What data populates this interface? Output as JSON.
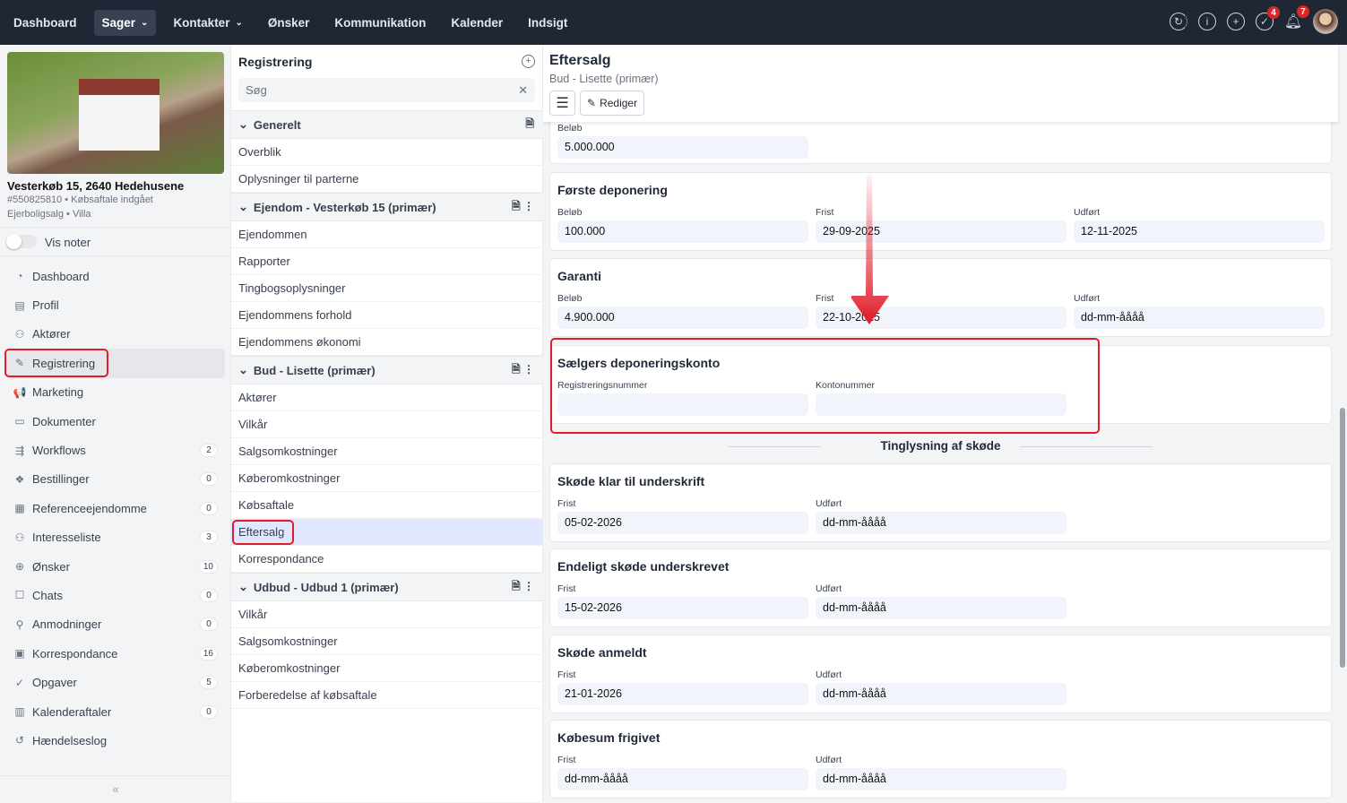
{
  "topnav": [
    {
      "label": "Dashboard"
    },
    {
      "label": "Sager",
      "active": true,
      "chevron": true
    },
    {
      "label": "Kontakter",
      "chevron": true
    },
    {
      "label": "Ønsker"
    },
    {
      "label": "Kommunikation"
    },
    {
      "label": "Kalender"
    },
    {
      "label": "Indsigt"
    }
  ],
  "top_icons": {
    "refresh": "refresh-icon",
    "info": "info-icon",
    "add": "plus-circle-icon",
    "tasks_badge": "4",
    "notifications_badge": "7"
  },
  "property": {
    "address": "Vesterkøb 15, 2640 Hedehusene",
    "case_line": "#550825810 • Købsaftale indgået",
    "type_line": "Ejerboligsalg • Villa",
    "notes_toggle": "Vis noter"
  },
  "menu": [
    {
      "label": "Dashboard",
      "icon": "◔",
      "count": null
    },
    {
      "label": "Profil",
      "icon": "▤",
      "count": null
    },
    {
      "label": "Aktører",
      "icon": "⚇",
      "count": null
    },
    {
      "label": "Registrering",
      "icon": "✎",
      "count": null,
      "active": true
    },
    {
      "label": "Marketing",
      "icon": "📢",
      "count": null
    },
    {
      "label": "Dokumenter",
      "icon": "▭",
      "count": null
    },
    {
      "label": "Workflows",
      "icon": "⇶",
      "count": "2"
    },
    {
      "label": "Bestillinger",
      "icon": "❖",
      "count": "0"
    },
    {
      "label": "Referenceejendomme",
      "icon": "▦",
      "count": "0"
    },
    {
      "label": "Interesseliste",
      "icon": "⚇",
      "count": "3"
    },
    {
      "label": "Ønsker",
      "icon": "⊕",
      "count": "10"
    },
    {
      "label": "Chats",
      "icon": "☐",
      "count": "0"
    },
    {
      "label": "Anmodninger",
      "icon": "⚲",
      "count": "0"
    },
    {
      "label": "Korrespondance",
      "icon": "▣",
      "count": "16"
    },
    {
      "label": "Opgaver",
      "icon": "✓",
      "count": "5"
    },
    {
      "label": "Kalenderaftaler",
      "icon": "▥",
      "count": "0"
    },
    {
      "label": "Hændelseslog",
      "icon": "↺",
      "count": null
    }
  ],
  "registrering": {
    "title": "Registrering",
    "search_placeholder": "Søg",
    "groups": [
      {
        "label": "Generelt",
        "items": [
          "Overblik",
          "Oplysninger til parterne"
        ],
        "more": false
      },
      {
        "label": "Ejendom - Vesterkøb 15 (primær)",
        "items": [
          "Ejendommen",
          "Rapporter",
          "Tingbogsoplysninger",
          "Ejendommens forhold",
          "Ejendommens økonomi"
        ],
        "more": true
      },
      {
        "label": "Bud - Lisette (primær)",
        "items": [
          "Aktører",
          "Vilkår",
          "Salgsomkostninger",
          "Køberomkostninger",
          "Købsaftale",
          "Eftersalg",
          "Korrespondance"
        ],
        "more": true
      },
      {
        "label": "Udbud - Udbud 1 (primær)",
        "items": [
          "Vilkår",
          "Salgsomkostninger",
          "Køberomkostninger",
          "Forberedelse af købsaftale"
        ],
        "more": true
      }
    ]
  },
  "main": {
    "title": "Eftersalg",
    "subtitle": "Bud - Lisette (primær)",
    "edit_label": "Rediger",
    "top_amount": {
      "label": "Beløb",
      "value": "5.000.000"
    },
    "cards1": [
      {
        "title": "Første deponering",
        "fields": [
          {
            "label": "Beløb",
            "value": "100.000"
          },
          {
            "label": "Frist",
            "value": "29-09-2025"
          },
          {
            "label": "Udført",
            "value": "12-11-2025"
          }
        ]
      },
      {
        "title": "Garanti",
        "fields": [
          {
            "label": "Beløb",
            "value": "4.900.000"
          },
          {
            "label": "Frist",
            "value": "22-10-2025"
          },
          {
            "label": "Udført",
            "value": "dd-mm-åååå"
          }
        ]
      },
      {
        "title": "Sælgers deponeringskonto",
        "fields": [
          {
            "label": "Registreringsnummer",
            "value": ""
          },
          {
            "label": "Kontonummer",
            "value": ""
          }
        ]
      }
    ],
    "section": "Tinglysning af skøde",
    "cards2": [
      {
        "title": "Skøde klar til underskrift",
        "fields": [
          {
            "label": "Frist",
            "value": "05-02-2026"
          },
          {
            "label": "Udført",
            "value": "dd-mm-åååå"
          }
        ]
      },
      {
        "title": "Endeligt skøde underskrevet",
        "fields": [
          {
            "label": "Frist",
            "value": "15-02-2026"
          },
          {
            "label": "Udført",
            "value": "dd-mm-åååå"
          }
        ]
      },
      {
        "title": "Skøde anmeldt",
        "fields": [
          {
            "label": "Frist",
            "value": "21-01-2026"
          },
          {
            "label": "Udført",
            "value": "dd-mm-åååå"
          }
        ]
      },
      {
        "title": "Købesum frigivet",
        "fields": [
          {
            "label": "Frist",
            "value": "dd-mm-åååå"
          },
          {
            "label": "Udført",
            "value": "dd-mm-åååå"
          }
        ]
      }
    ]
  },
  "colors": {
    "highlight": "#e11d2a",
    "topbar": "#1f2735"
  }
}
